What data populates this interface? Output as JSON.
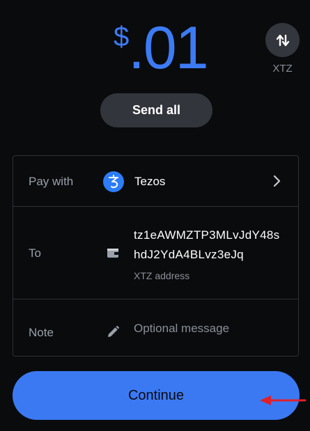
{
  "amount": {
    "currency_symbol": "$",
    "value": ".01"
  },
  "swap": {
    "icon": "swap-vertical-arrows-icon",
    "unit_label": "XTZ"
  },
  "send_all": {
    "label": "Send all"
  },
  "form": {
    "pay_with": {
      "label": "Pay with",
      "asset_name": "Tezos",
      "asset_icon": "tezos-icon"
    },
    "to": {
      "label": "To",
      "address_line1": "tz1eAWMZTP3MLvJdY48s",
      "address_line2": "hdJ2YdA4BLvz3eJq",
      "address_caption": "XTZ address",
      "icon": "wallet-icon"
    },
    "note": {
      "label": "Note",
      "placeholder": "Optional message",
      "value": "",
      "icon": "pencil-icon"
    }
  },
  "continue": {
    "label": "Continue"
  },
  "colors": {
    "background": "#0a0b0d",
    "accent": "#3b79f3",
    "annotation": "#e0202a"
  }
}
